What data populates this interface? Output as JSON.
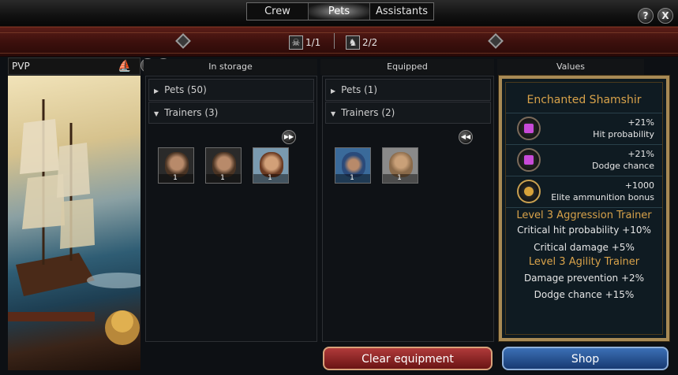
{
  "tabs": [
    {
      "label": "Crew",
      "active": false
    },
    {
      "label": "Pets",
      "active": true
    },
    {
      "label": "Assistants",
      "active": false
    }
  ],
  "header_buttons": {
    "help": "?",
    "close": "X"
  },
  "counters": [
    {
      "icon": "skull-icon",
      "value": "1/1"
    },
    {
      "icon": "pet-icon",
      "value": "2/2"
    }
  ],
  "left": {
    "title": "PVP",
    "ship_icon": "ship-icon",
    "filter_icon": "filter-icon",
    "add_icon": "plus-icon"
  },
  "columns": {
    "storage": "In storage",
    "equipped": "Equipped",
    "values": "Values"
  },
  "storage": {
    "rows": [
      {
        "label": "Pets (50)",
        "expanded": false
      },
      {
        "label": "Trainers (3)",
        "expanded": true
      }
    ],
    "action_icon": "forward-icon",
    "items": [
      {
        "name": "trainer-1",
        "count": "1",
        "hair": "#4a3424",
        "skin": "#b88a6a"
      },
      {
        "name": "trainer-2",
        "count": "1",
        "hair": "#4a3424",
        "skin": "#b88a6a"
      },
      {
        "name": "trainer-3",
        "count": "1",
        "hair": "#6a3a22",
        "skin": "#d2a078"
      }
    ]
  },
  "equipped": {
    "rows": [
      {
        "label": "Pets (1)",
        "expanded": false
      },
      {
        "label": "Trainers (2)",
        "expanded": true
      }
    ],
    "action_icon": "rewind-icon",
    "items": [
      {
        "name": "trainer-blue",
        "count": "1",
        "hair": "#2a4a7a",
        "skin": "#b88a6a"
      },
      {
        "name": "trainer-bearded",
        "count": "1",
        "hair": "#8a6a4a",
        "skin": "#c9a078"
      }
    ]
  },
  "values": {
    "title": "Enchanted Shamshir",
    "bonuses": [
      {
        "value": "+21%",
        "label": "Hit probability",
        "icon": "purple-gem-icon",
        "color": "#c84ad8"
      },
      {
        "value": "+21%",
        "label": "Dodge chance",
        "icon": "purple-gem-icon",
        "color": "#c84ad8"
      },
      {
        "value": "+1000",
        "label": "Elite ammunition bonus",
        "icon": "ammo-icon",
        "color": "#d8a23a"
      }
    ],
    "trainers": [
      {
        "title": "Level 3 Aggression Trainer",
        "lines": [
          "Critical hit probability +10%",
          "Critical damage +5%"
        ]
      },
      {
        "title": "Level 3 Agility Trainer",
        "lines": [
          "Damage prevention +2%",
          "Dodge chance +15%"
        ]
      }
    ]
  },
  "buttons": {
    "clear": "Clear equipment",
    "shop": "Shop"
  },
  "colors": {
    "accent_gold": "#d8a24a",
    "band_red": "#4a1410",
    "clear_red": "#8a1e1e",
    "shop_blue": "#2a5292"
  }
}
